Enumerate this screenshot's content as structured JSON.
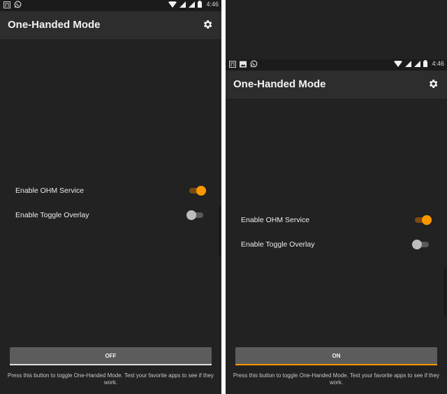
{
  "colors": {
    "accent": "#ff9800",
    "background": "#222222",
    "appbar": "#2d2d2d",
    "button": "#5c5c5c"
  },
  "screens": [
    {
      "status_bar": {
        "time": "4:46",
        "left_icons": [
          "notification-grid-icon",
          "whatsapp-icon"
        ],
        "right_icons": [
          "wifi-icon",
          "signal-icon",
          "signal-icon",
          "battery-icon"
        ]
      },
      "app_bar": {
        "title": "One-Handed Mode",
        "settings_icon": "gear-icon"
      },
      "settings": [
        {
          "label": "Enable OHM Service",
          "checked": true
        },
        {
          "label": "Enable Toggle Overlay",
          "checked": false
        }
      ],
      "toggle_button": {
        "label": "OFF",
        "state": "off"
      },
      "hint": "Press this button to toggle One-Handed Mode. Test your favorite apps to see if they work."
    },
    {
      "status_bar": {
        "time": "4:46",
        "left_icons": [
          "notification-grid-icon",
          "image-icon",
          "whatsapp-icon"
        ],
        "right_icons": [
          "wifi-icon",
          "signal-icon",
          "signal-icon",
          "battery-icon"
        ]
      },
      "app_bar": {
        "title": "One-Handed Mode",
        "settings_icon": "gear-icon"
      },
      "settings": [
        {
          "label": "Enable OHM Service",
          "checked": true
        },
        {
          "label": "Enable Toggle Overlay",
          "checked": false
        }
      ],
      "toggle_button": {
        "label": "ON",
        "state": "on"
      },
      "hint": "Press this button to toggle One-Handed Mode. Test your favorite apps to see if they work."
    }
  ]
}
